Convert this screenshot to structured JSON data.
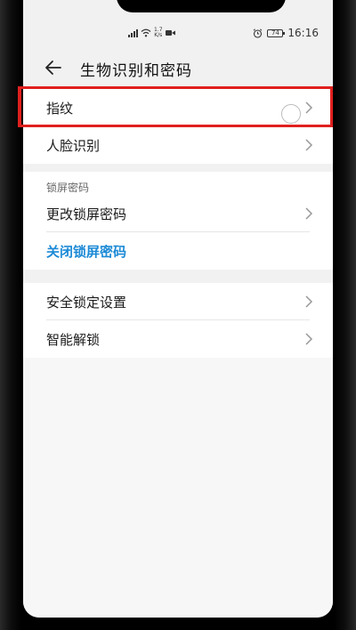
{
  "status_bar": {
    "network_speed_value": "1.7",
    "network_speed_unit": "K/s",
    "battery": "74",
    "time": "16:16",
    "icons": [
      "signal-4g-icon",
      "wifi-icon",
      "video-icon",
      "alarm-icon",
      "battery-icon"
    ]
  },
  "header": {
    "title": "生物识别和密码",
    "back_icon": "arrow-left-icon"
  },
  "biometrics": [
    {
      "label": "指纹"
    },
    {
      "label": "人脸识别"
    }
  ],
  "lock_screen": {
    "section_label": "锁屏密码",
    "change_label": "更改锁屏密码",
    "disable_label": "关闭锁屏密码"
  },
  "security": [
    {
      "label": "安全锁定设置"
    },
    {
      "label": "智能解锁"
    }
  ],
  "colors": {
    "accent": "#1c8ad6",
    "highlight": "#e0201e"
  }
}
